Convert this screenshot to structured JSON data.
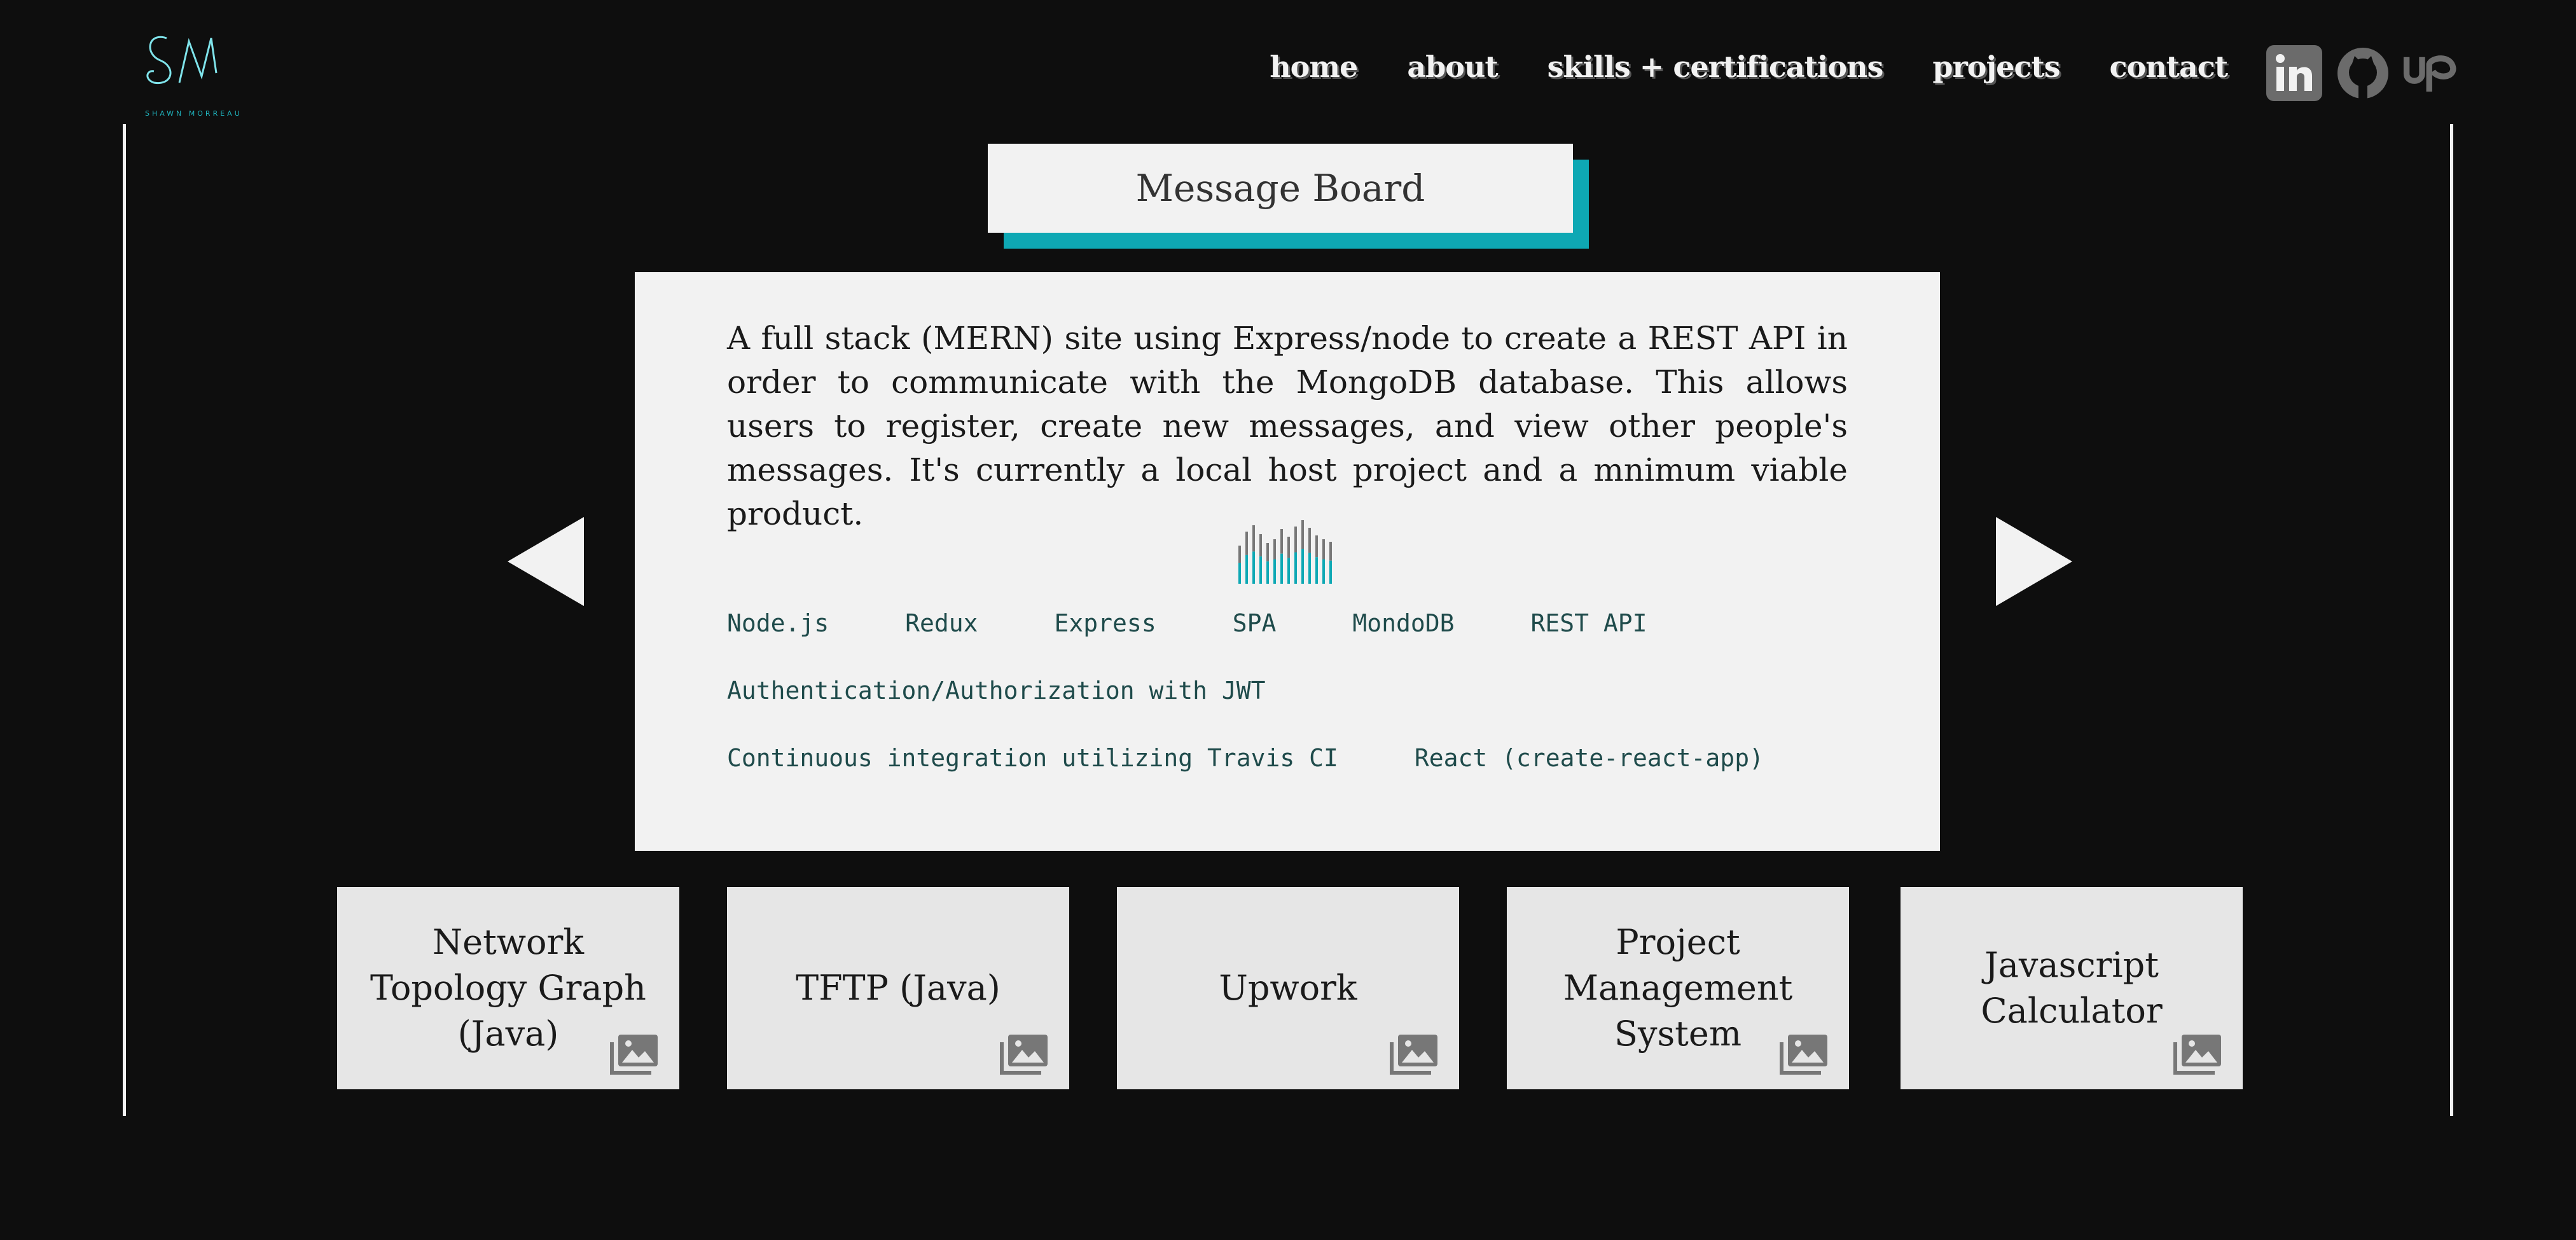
{
  "brand": {
    "logo_letters": "SM",
    "logo_caption": "SHAWN MORREAU"
  },
  "nav": {
    "items": [
      "home",
      "about",
      "skills + certifications",
      "projects",
      "contact"
    ]
  },
  "social": {
    "icons": [
      "linkedin-icon",
      "github-icon",
      "upwork-icon"
    ]
  },
  "project": {
    "title": "Message Board",
    "description": "A full stack (MERN) site using Express/node to create a REST API in order to communicate with the MongoDB database. This allows users to register, create new messages, and view other people's messages. It's currently a local host project and a mnimum viable product.",
    "tags_rows": [
      [
        "Node.js",
        "Redux",
        "Express",
        "SPA",
        "MondoDB",
        "REST API"
      ],
      [
        "Authentication/Authorization with JWT"
      ],
      [
        "Continuous integration utilizing Travis CI",
        "React (create-react-app)"
      ]
    ]
  },
  "projects": [
    {
      "label": "Network Topology Graph (Java)"
    },
    {
      "label": "TFTP (Java)"
    },
    {
      "label": "Upwork"
    },
    {
      "label": "Project Management System"
    },
    {
      "label": "Javascript Calculator"
    }
  ],
  "colors": {
    "accent": "#0ea8b4",
    "background": "#0e0e0e",
    "panel": "#f2f2f2"
  }
}
